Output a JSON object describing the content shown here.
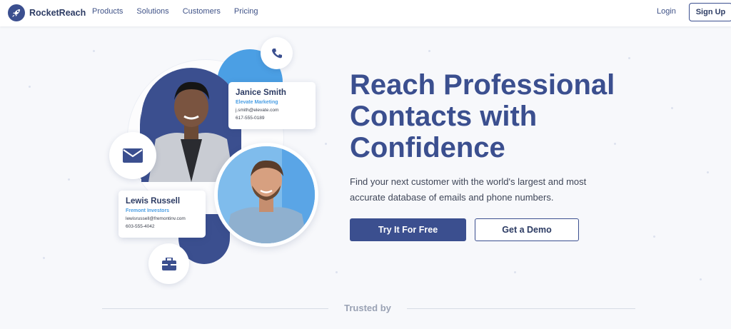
{
  "brand": {
    "name": "RocketReach",
    "logo_icon": "rocket-icon"
  },
  "nav": {
    "items": [
      {
        "label": "Products"
      },
      {
        "label": "Solutions"
      },
      {
        "label": "Customers"
      },
      {
        "label": "Pricing"
      }
    ],
    "login_label": "Login",
    "signup_label": "Sign Up"
  },
  "hero": {
    "title": "Reach Professional Contacts with Confidence",
    "subtitle": "Find your next customer with the world's largest and most accurate database of emails and phone numbers.",
    "primary_cta": "Try It For Free",
    "secondary_cta": "Get a Demo"
  },
  "contacts": [
    {
      "name": "Janice Smith",
      "company": "Elevate Marketing",
      "email": "j.smith@elevate.com",
      "phone": "617-555-0189"
    },
    {
      "name": "Lewis Russell",
      "company": "Fremont Investors",
      "email": "lewisrussell@fremontinv.com",
      "phone": "603-555-4042"
    }
  ],
  "icons": [
    "phone-icon",
    "email-icon",
    "briefcase-icon"
  ],
  "trusted_by": "Trusted by",
  "colors": {
    "navy": "#3b4f8f",
    "light_blue": "#4b9fe4",
    "text": "#3f4658",
    "muted": "#9aa2b4"
  }
}
